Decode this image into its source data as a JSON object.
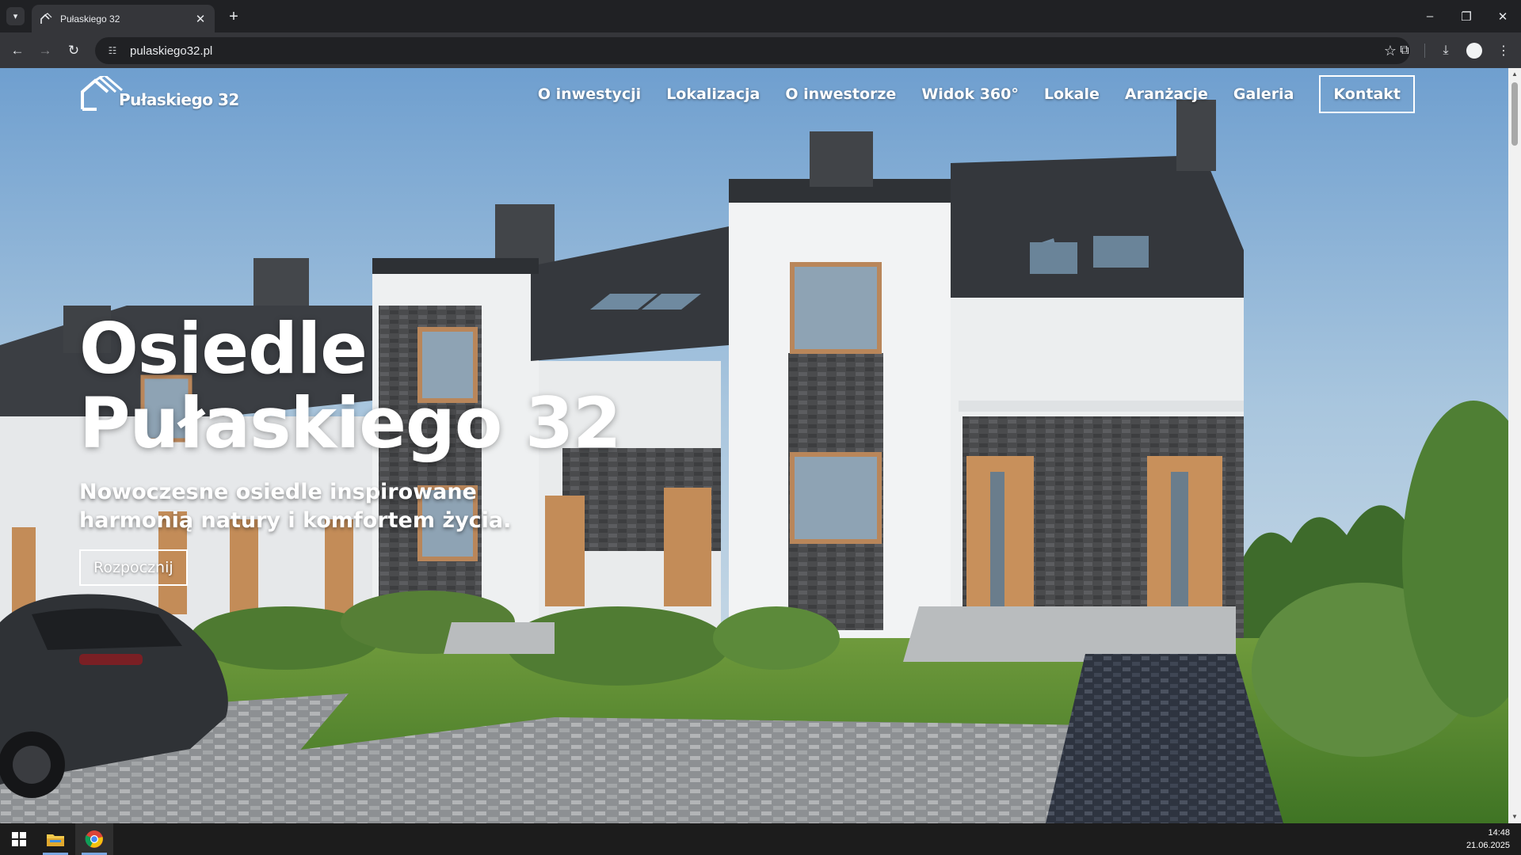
{
  "browser": {
    "tab_title": "Pułaskiego 32",
    "url": "pulaskiego32.pl",
    "icons": [
      "tab-search-icon",
      "close-icon",
      "plus-icon",
      "minimize-icon",
      "restore-icon",
      "close-window-icon",
      "back-icon",
      "forward-icon",
      "reload-icon",
      "site-info-icon",
      "star-icon",
      "extensions-icon",
      "download-icon",
      "profile-icon",
      "menu-icon"
    ]
  },
  "site": {
    "logo_text": "Pułaskiego 32",
    "nav": {
      "items": [
        {
          "label": "O inwestycji"
        },
        {
          "label": "Lokalizacja"
        },
        {
          "label": "O inwestorze"
        },
        {
          "label": "Widok 360°"
        },
        {
          "label": "Lokale"
        },
        {
          "label": "Aranżacje"
        },
        {
          "label": "Galeria"
        }
      ],
      "contact_label": "Kontakt"
    },
    "hero": {
      "title_line1": "Osiedle",
      "title_line2": "Pułaskiego 32",
      "subtitle": "Nowoczesne osiedle inspirowane harmonią natury i komfortem życia.",
      "cta_label": "Rozpocznij"
    }
  },
  "taskbar": {
    "time": "14:48",
    "date": "21.06.2025",
    "apps": [
      "windows-start",
      "file-explorer",
      "google-chrome"
    ]
  },
  "colors": {
    "chrome_dark": "#202124",
    "chrome_toolbar": "#35363a",
    "taskbar": "#1c1c1c",
    "hero_text": "#ffffff"
  }
}
